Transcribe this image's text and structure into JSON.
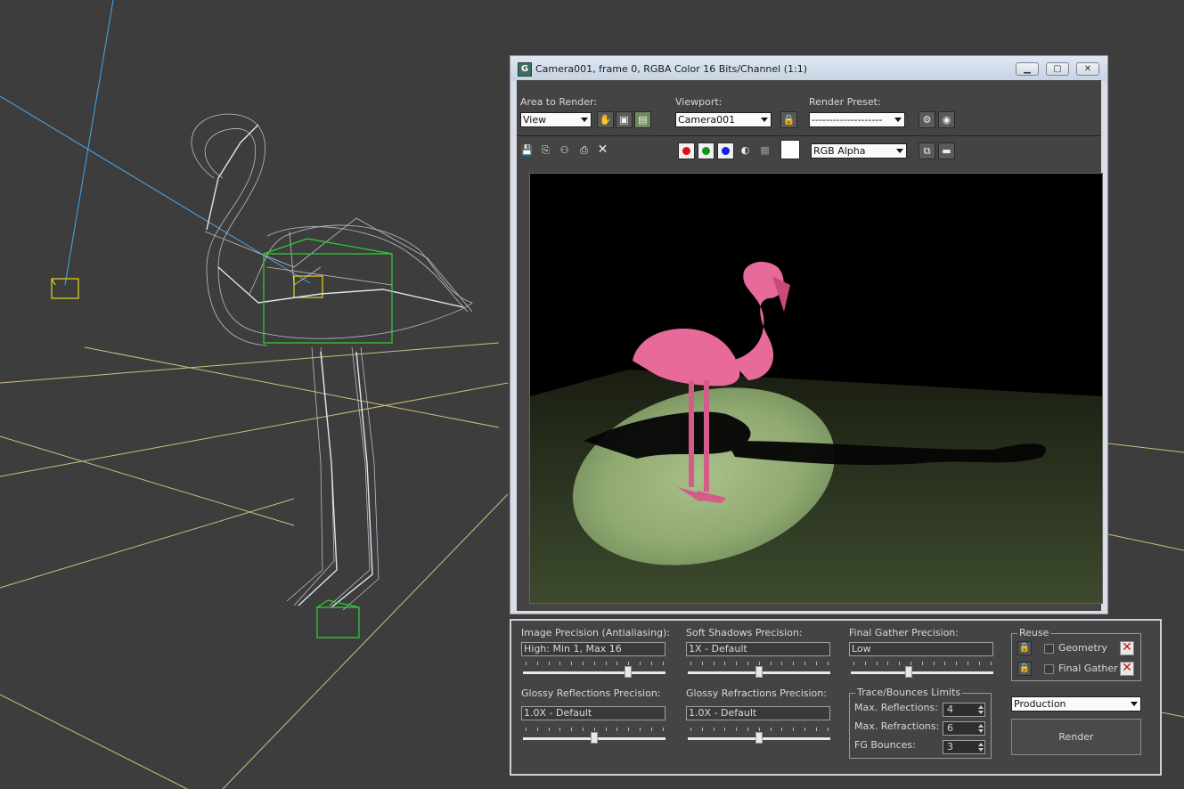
{
  "window": {
    "title": "Camera001, frame 0, RGBA Color 16 Bits/Channel (1:1)",
    "app_icon": "G",
    "controls": {
      "minimize": "▁",
      "maximize": "▢",
      "close": "✕"
    }
  },
  "toolbar": {
    "area_label": "Area to Render:",
    "area_value": "View",
    "viewport_label": "Viewport:",
    "viewport_value": "Camera001",
    "preset_label": "Render Preset:",
    "preset_value": "--------------------",
    "channel_value": "RGB Alpha",
    "icons": [
      "pan-hand-icon",
      "region-icon",
      "auto-region-icon",
      "lock-icon",
      "render-setup-icon",
      "environment-icon",
      "save-icon",
      "copy-icon",
      "clone-icon",
      "print-icon",
      "clear-icon",
      "red-channel-icon",
      "green-channel-icon",
      "blue-channel-icon",
      "alpha-icon",
      "mono-icon",
      "display-toggle-icon",
      "info-panel-icon"
    ]
  },
  "colors": {
    "red": "#e01010",
    "green": "#109a10",
    "blue": "#1020e0",
    "swatch": "#ffffff",
    "flamingo": "#e86a9a",
    "grid": "#e6d68a",
    "wire": "#c8ccd8",
    "helper_green": "#2fd12f",
    "helper_yellow": "#e8d51a",
    "light_line": "#4aa8e8"
  },
  "panel": {
    "image_precision_label": "Image Precision (Antialiasing):",
    "image_precision_value": "High: Min 1, Max 16",
    "image_precision_level": 0.75,
    "soft_shadows_label": "Soft Shadows Precision:",
    "soft_shadows_value": "1X - Default",
    "soft_shadows_level": 0.5,
    "final_gather_label": "Final Gather Precision:",
    "final_gather_value": "Low",
    "final_gather_level": 0.4,
    "glossy_reflections_label": "Glossy Reflections Precision:",
    "glossy_reflections_value": "1.0X - Default",
    "glossy_reflections_level": 0.5,
    "glossy_refractions_label": "Glossy Refractions Precision:",
    "glossy_refractions_value": "1.0X - Default",
    "glossy_refractions_level": 0.5,
    "reuse": {
      "title": "Reuse",
      "geometry_label": "Geometry",
      "final_gather_label": "Final Gather"
    },
    "trace": {
      "title": "Trace/Bounces Limits",
      "max_reflections_label": "Max. Reflections:",
      "max_reflections_value": "4",
      "max_refractions_label": "Max. Refractions:",
      "max_refractions_value": "6",
      "fg_bounces_label": "FG Bounces:",
      "fg_bounces_value": "3"
    },
    "mode_value": "Production",
    "render_label": "Render"
  }
}
